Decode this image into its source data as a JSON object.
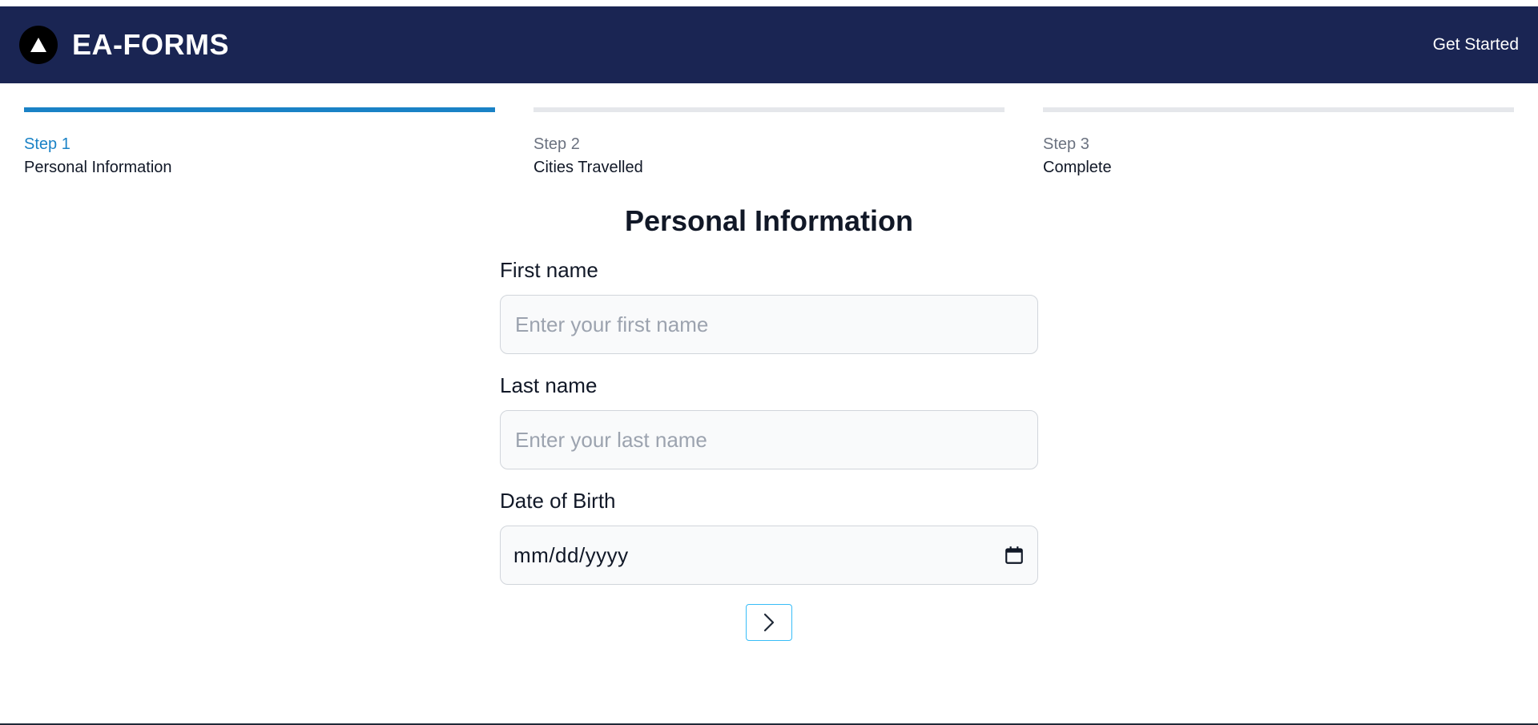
{
  "header": {
    "brand_name": "EA-FORMS",
    "get_started_label": "Get Started",
    "background_color": "#1a2553"
  },
  "stepper": {
    "active_color": "#1a82c6",
    "steps": [
      {
        "number": "Step 1",
        "title": "Personal Information",
        "active": true
      },
      {
        "number": "Step 2",
        "title": "Cities Travelled",
        "active": false
      },
      {
        "number": "Step 3",
        "title": "Complete",
        "active": false
      }
    ]
  },
  "form": {
    "title": "Personal Information",
    "fields": {
      "first_name": {
        "label": "First name",
        "placeholder": "Enter your first name",
        "value": ""
      },
      "last_name": {
        "label": "Last name",
        "placeholder": "Enter your last name",
        "value": ""
      },
      "dob": {
        "label": "Date of Birth",
        "value": "mm/dd/yyyy",
        "icon": "calendar-icon"
      }
    },
    "next_button_icon": "chevron-right-icon"
  }
}
